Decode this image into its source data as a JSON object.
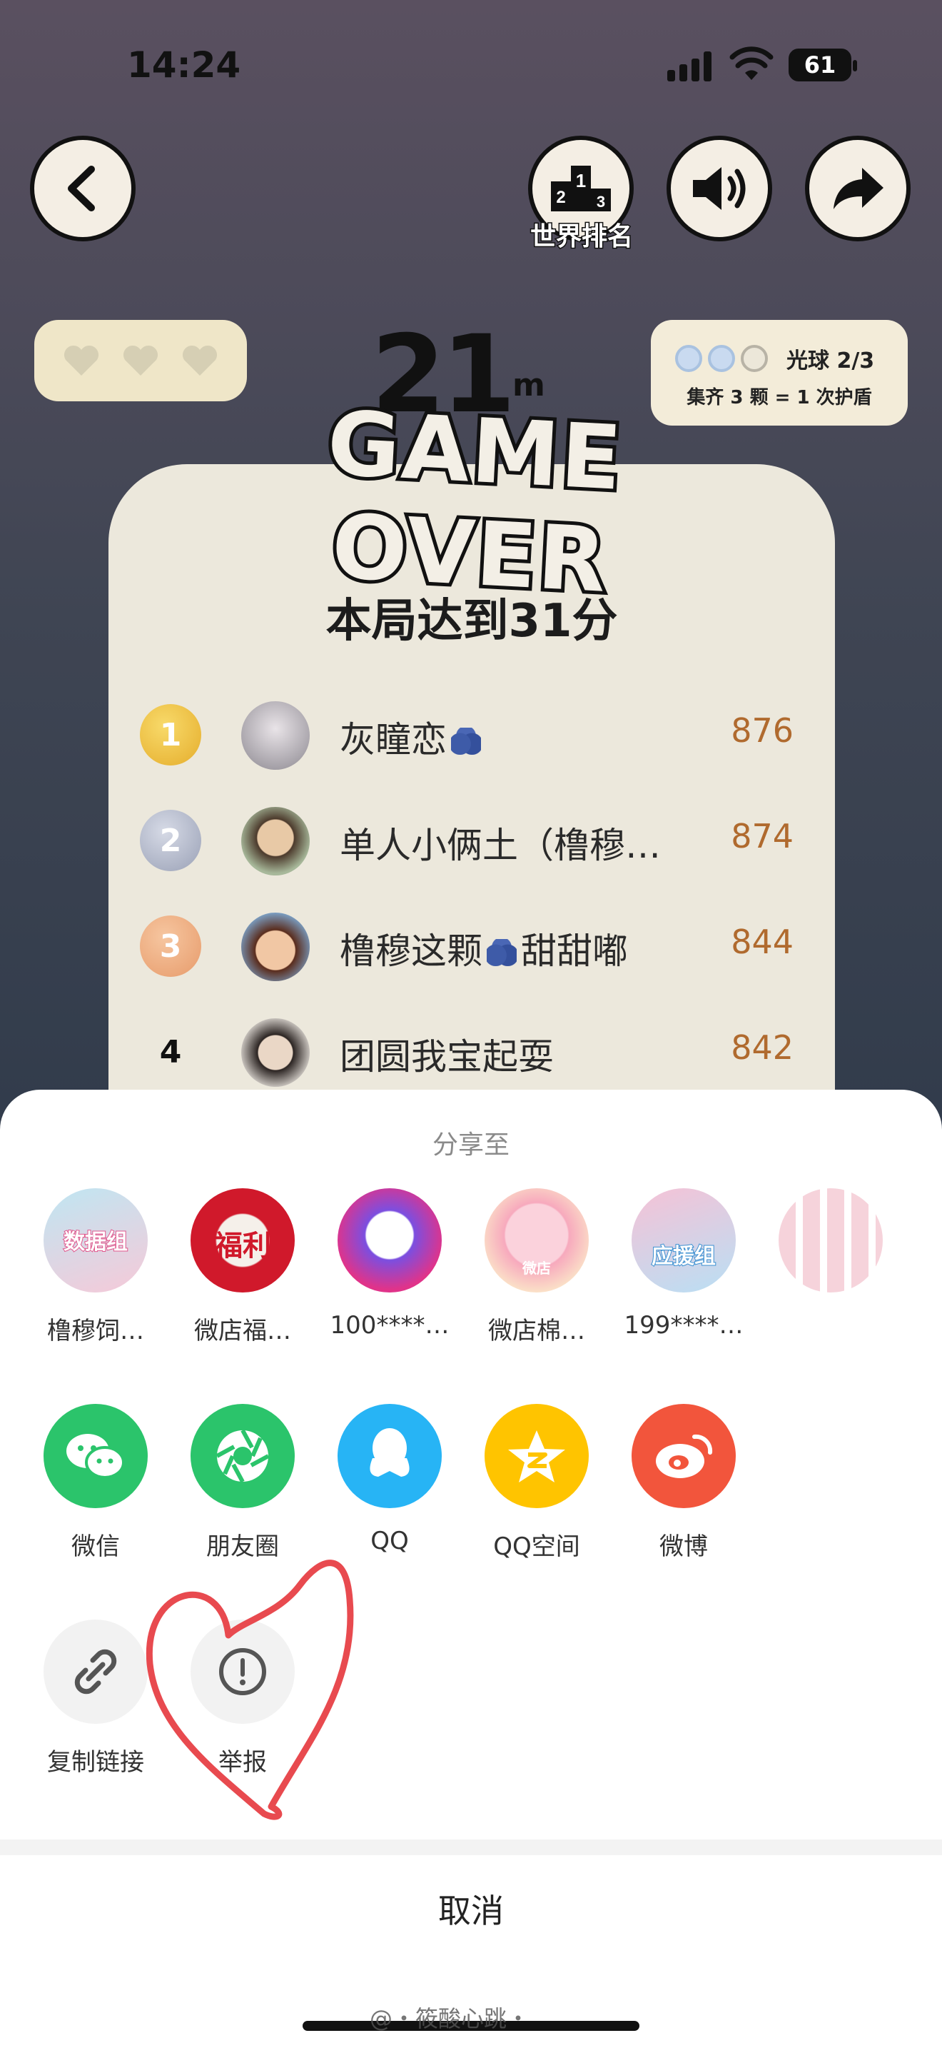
{
  "status_bar": {
    "time": "14:24",
    "battery": "61"
  },
  "top": {
    "rank_label": "世界排名"
  },
  "orb_card": {
    "label": "光球 2/3",
    "note": "集齐 3 颗 = 1 次护盾",
    "collected": 2,
    "total": 3
  },
  "game": {
    "distance": "21",
    "distance_unit": "m",
    "over_text": "GAME OVER",
    "score_title": "本局达到31分"
  },
  "leaderboard": [
    {
      "rank": "1",
      "name": "灰瞳恋",
      "score": "876"
    },
    {
      "rank": "2",
      "name": "单人小俩土（橹穆…",
      "score": "874"
    },
    {
      "rank": "3",
      "name": "橹穆这颗",
      "name_suffix": "甜甜嘟",
      "score": "844"
    },
    {
      "rank": "4",
      "name": "团圆我宝起耍",
      "score": "842"
    }
  ],
  "share_sheet": {
    "title": "分享至",
    "contacts": [
      {
        "label": "橹穆饲…",
        "avatar_text": "数据组"
      },
      {
        "label": "微店福…",
        "avatar_text": "福利"
      },
      {
        "label": "100****…",
        "avatar_text": ""
      },
      {
        "label": "微店棉…",
        "avatar_text": "微店"
      },
      {
        "label": "199****…",
        "avatar_text": "应援组"
      }
    ],
    "apps": [
      {
        "label": "微信",
        "icon": "wechat-icon",
        "color": "#2bc46b"
      },
      {
        "label": "朋友圈",
        "icon": "moments-icon",
        "color": "#2bc46b"
      },
      {
        "label": "QQ",
        "icon": "qq-icon",
        "color": "#27b4f5"
      },
      {
        "label": "QQ空间",
        "icon": "qzone-icon",
        "color": "#ffc400"
      },
      {
        "label": "微博",
        "icon": "weibo-icon",
        "color": "#f2553c"
      }
    ],
    "tools": [
      {
        "label": "复制链接",
        "icon": "link-icon"
      },
      {
        "label": "举报",
        "icon": "report-icon"
      }
    ],
    "cancel": "取消"
  },
  "watermark": "@・筱酸心跳・"
}
